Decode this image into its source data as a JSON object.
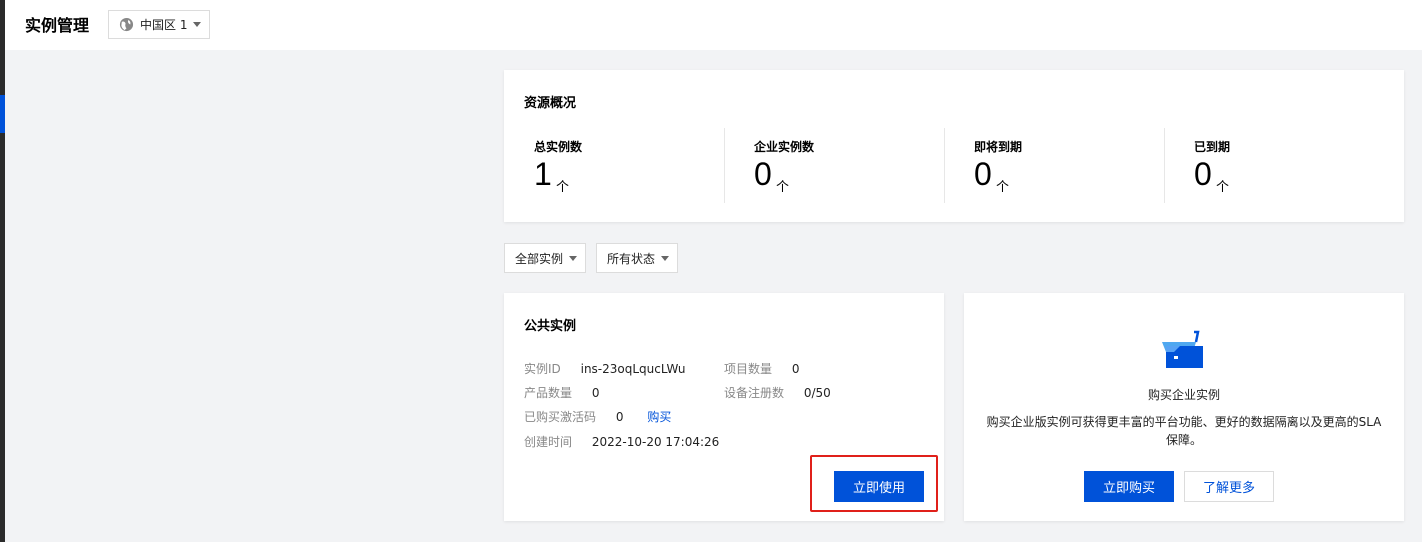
{
  "header": {
    "title": "实例管理",
    "region": "中国区 1"
  },
  "overview": {
    "title": "资源概况",
    "stats": [
      {
        "label": "总实例数",
        "value": "1",
        "unit": "个"
      },
      {
        "label": "企业实例数",
        "value": "0",
        "unit": "个"
      },
      {
        "label": "即将到期",
        "value": "0",
        "unit": "个"
      },
      {
        "label": "已到期",
        "value": "0",
        "unit": "个"
      }
    ]
  },
  "filters": {
    "instance_type": "全部实例",
    "status": "所有状态"
  },
  "public_instance": {
    "title": "公共实例",
    "instance_id_label": "实例ID",
    "instance_id": "ins-23oqLqucLWu",
    "project_count_label": "项目数量",
    "project_count": "0",
    "product_count_label": "产品数量",
    "product_count": "0",
    "device_count_label": "设备注册数",
    "device_count": "0/50",
    "activation_label": "已购买激活码",
    "activation_count": "0",
    "buy_link": "购买",
    "created_label": "创建时间",
    "created_at": "2022-10-20 17:04:26",
    "use_button": "立即使用"
  },
  "enterprise": {
    "title": "购买企业实例",
    "description": "购买企业版实例可获得更丰富的平台功能、更好的数据隔离以及更高的SLA保障。",
    "buy_button": "立即购买",
    "learn_more_button": "了解更多"
  },
  "colors": {
    "primary": "#0052d9",
    "highlight": "#e0201a",
    "background": "#f2f3f5"
  }
}
